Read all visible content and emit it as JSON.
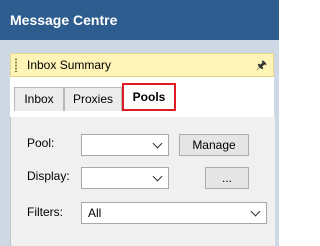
{
  "window": {
    "title": "Message Centre"
  },
  "summary": {
    "title": "Inbox Summary",
    "pin_icon": "pin-icon"
  },
  "tabs": [
    {
      "label": "Inbox"
    },
    {
      "label": "Proxies"
    },
    {
      "label": "Pools"
    }
  ],
  "form": {
    "pool_label": "Pool:",
    "pool_value": "",
    "manage_label": "Manage",
    "display_label": "Display:",
    "display_value": "",
    "browse_label": "...",
    "filters_label": "Filters:",
    "filters_value": "All"
  },
  "colors": {
    "title_bar": "#2d5c8f",
    "summary_header": "#fff4b8",
    "active_tab_highlight": "#e01b24"
  }
}
